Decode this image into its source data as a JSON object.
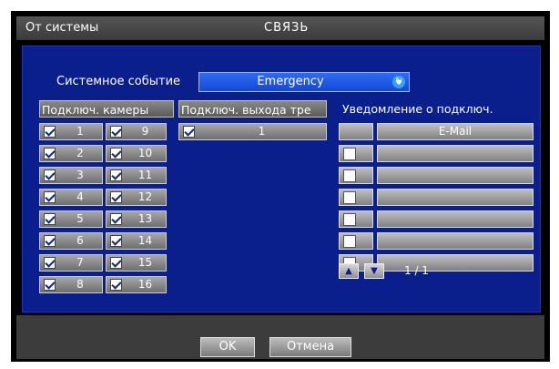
{
  "window": {
    "left_title": "От системы",
    "center_title": "СВЯЗЬ"
  },
  "event": {
    "label": "Системное событие",
    "value": "Emergency",
    "refresh_icon": "refresh-icon"
  },
  "cameras": {
    "header": "Подключ. камеры",
    "items": [
      {
        "n": "1",
        "checked": true
      },
      {
        "n": "2",
        "checked": true
      },
      {
        "n": "3",
        "checked": true
      },
      {
        "n": "4",
        "checked": true
      },
      {
        "n": "5",
        "checked": true
      },
      {
        "n": "6",
        "checked": true
      },
      {
        "n": "7",
        "checked": true
      },
      {
        "n": "8",
        "checked": true
      },
      {
        "n": "9",
        "checked": true
      },
      {
        "n": "10",
        "checked": true
      },
      {
        "n": "11",
        "checked": true
      },
      {
        "n": "12",
        "checked": true
      },
      {
        "n": "13",
        "checked": true
      },
      {
        "n": "14",
        "checked": true
      },
      {
        "n": "15",
        "checked": true
      },
      {
        "n": "16",
        "checked": true
      }
    ]
  },
  "outputs": {
    "header": "Подключ. выхода тре",
    "items": [
      {
        "n": "1",
        "checked": true
      }
    ]
  },
  "notify": {
    "header": "Уведомление о подключ.",
    "col_email": "E-Mail",
    "rows": [
      {
        "checked": false,
        "email": ""
      },
      {
        "checked": false,
        "email": ""
      },
      {
        "checked": false,
        "email": ""
      },
      {
        "checked": false,
        "email": ""
      },
      {
        "checked": false,
        "email": ""
      },
      {
        "checked": false,
        "email": ""
      }
    ],
    "page": "1 / 1",
    "prev_icon": "triangle-up-icon",
    "next_icon": "triangle-down-icon"
  },
  "buttons": {
    "ok": "OK",
    "cancel": "Отмена"
  },
  "colors": {
    "panel": "#0a1f8c",
    "dropdown": "#1f5be6",
    "window": "#000000"
  }
}
